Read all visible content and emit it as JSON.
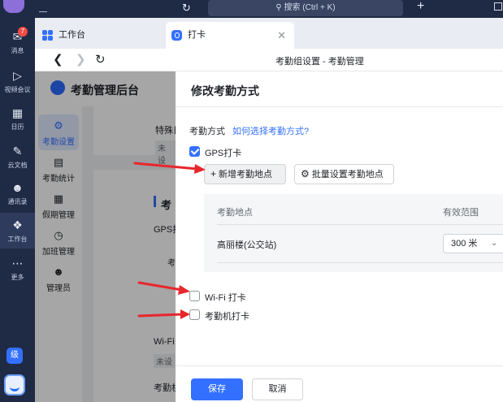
{
  "titlebar": {
    "search_placeholder": "搜索 (Ctrl + K)"
  },
  "rail": {
    "notification_count": "7",
    "items": [
      {
        "label": "消息"
      },
      {
        "label": "视频会议"
      },
      {
        "label": "日历"
      },
      {
        "label": "云文档"
      },
      {
        "label": "通讯录"
      },
      {
        "label": "工作台"
      },
      {
        "label": "更多"
      }
    ],
    "level_badge": "级"
  },
  "tabs": [
    {
      "label": "工作台"
    },
    {
      "label": "打卡"
    }
  ],
  "navbar": {
    "title": "考勤组设置 - 考勤管理"
  },
  "app": {
    "name": "考勤管理后台",
    "nav": [
      {
        "label": "考勤设置"
      },
      {
        "label": "考勤统计"
      },
      {
        "label": "假期管理"
      },
      {
        "label": "加班管理"
      },
      {
        "label": "管理员"
      }
    ],
    "background_texts": [
      "特殊日",
      "未设",
      "考",
      "GPS打",
      "考",
      "Wi-Fi",
      "未设",
      "考勤机"
    ]
  },
  "drawer": {
    "title": "修改考勤方式",
    "method_label": "考勤方式",
    "method_help_link": "如何选择考勤方式?",
    "gps": {
      "label": "GPS打卡",
      "checked": true
    },
    "add_location_label": "新增考勤地点",
    "batch_location_label": "批量设置考勤地点",
    "location_table": {
      "headers": [
        "考勤地点",
        "有效范围"
      ],
      "rows": [
        {
          "name": "高丽楼(公交站)",
          "range": "300 米"
        }
      ]
    },
    "wifi": {
      "label": "Wi-Fi 打卡",
      "checked": false
    },
    "machine": {
      "label": "考勤机打卡",
      "checked": false
    },
    "save_label": "保存",
    "cancel_label": "取消"
  },
  "colors": {
    "accent": "#3370ff",
    "rail_bg": "#1f2a44",
    "annotation_arrow": "#e8262c"
  }
}
